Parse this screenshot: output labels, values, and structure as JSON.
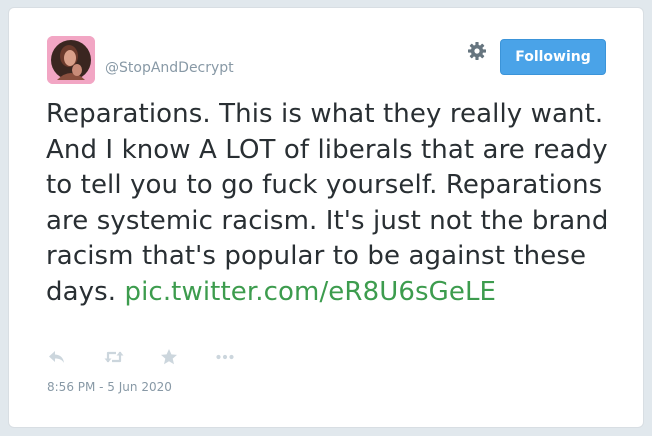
{
  "tweet": {
    "handle": "@StopAndDecrypt",
    "follow_button_label": "Following",
    "text_body": "Reparations. This is what they really want. And I know A LOT of liberals that are ready to tell you to go fuck yourself. Reparations are systemic racism. It's just not the brand racism that's popular to be against these days. ",
    "link_text": "pic.twitter.com/eR8U6sGeLE",
    "timestamp": "8:56 PM - 5 Jun 2020"
  },
  "icons": {
    "settings": "gear-icon",
    "reply": "reply-icon",
    "retweet": "retweet-icon",
    "like": "star-icon",
    "more": "more-icon"
  },
  "colors": {
    "follow_button": "#4aa3e8",
    "link": "#3d9c4e",
    "text": "#292f33",
    "muted": "#8899a6",
    "avatar_bg": "#f2a6c4"
  }
}
